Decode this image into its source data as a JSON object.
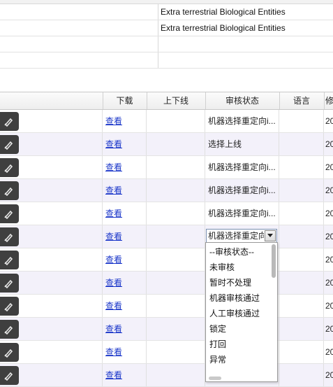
{
  "upper": {
    "rows": [
      {
        "text": "Extra terrestrial Biological Entities"
      },
      {
        "text": "Extra terrestrial Biological Entities"
      }
    ]
  },
  "grid": {
    "headers": {
      "download": "下载",
      "online": "上下线",
      "review_status": "审核状态",
      "language": "语言",
      "modified": "修"
    },
    "rows": [
      {
        "view": "查看",
        "status": "机器选择重定向i...",
        "mod": "20"
      },
      {
        "view": "查看",
        "status": "选择上线",
        "mod": "20"
      },
      {
        "view": "查看",
        "status": "机器选择重定向i...",
        "mod": "20"
      },
      {
        "view": "查看",
        "status": "机器选择重定向i...",
        "mod": "20"
      },
      {
        "view": "查看",
        "status": "机器选择重定向i...",
        "mod": "20"
      },
      {
        "view": "查看",
        "status": "",
        "mod": "20"
      },
      {
        "view": "查看",
        "status": "",
        "mod": "20"
      },
      {
        "view": "查看",
        "status": "",
        "mod": "20"
      },
      {
        "view": "查看",
        "status": "",
        "mod": "20"
      },
      {
        "view": "查看",
        "status": "",
        "mod": "20"
      },
      {
        "view": "查看",
        "status": "",
        "mod": "20"
      },
      {
        "view": "查看",
        "status": "",
        "mod": "20"
      }
    ],
    "select": {
      "value": "机器选择重定向"
    },
    "dropdown_options": [
      "--审核状态--",
      "未审核",
      "暂时不处理",
      "机器审核通过",
      "人工审核通过",
      "锁定",
      "打回",
      "异常"
    ]
  },
  "icons": {
    "row_action": "edit-pencil-icon"
  },
  "colors": {
    "link": "#1a36c9",
    "alt_row": "#f3f1fa",
    "icon_button": "#3f3f3f"
  }
}
